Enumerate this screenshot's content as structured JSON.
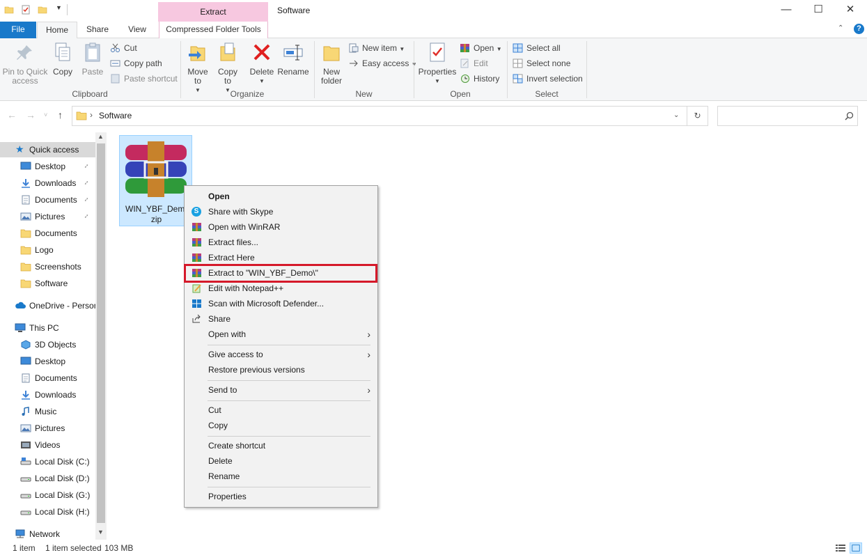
{
  "window": {
    "title": "Software",
    "contextual_tab_title": "Extract",
    "contextual_tab_group": "Compressed Folder Tools"
  },
  "tabs": {
    "file": "File",
    "home": "Home",
    "share": "Share",
    "view": "View"
  },
  "ribbon": {
    "clipboard": {
      "label": "Clipboard",
      "pin": "Pin to Quick access",
      "copy": "Copy",
      "paste": "Paste",
      "cut": "Cut",
      "copy_path": "Copy path",
      "paste_shortcut": "Paste shortcut"
    },
    "organize": {
      "label": "Organize",
      "move_to": "Move to",
      "copy_to": "Copy to",
      "delete": "Delete",
      "rename": "Rename"
    },
    "new": {
      "label": "New",
      "new_folder": "New folder",
      "new_item": "New item",
      "easy_access": "Easy access"
    },
    "open": {
      "label": "Open",
      "properties": "Properties",
      "open": "Open",
      "edit": "Edit",
      "history": "History"
    },
    "select": {
      "label": "Select",
      "select_all": "Select all",
      "select_none": "Select none",
      "invert": "Invert selection"
    }
  },
  "address": {
    "crumb": "Software",
    "search_placeholder": ""
  },
  "navpane": {
    "quick_access": "Quick access",
    "quick_items": [
      "Desktop",
      "Downloads",
      "Documents",
      "Pictures",
      "Documents",
      "Logo",
      "Screenshots",
      "Software"
    ],
    "onedrive": "OneDrive - Person",
    "this_pc": "This PC",
    "pc_items": [
      "3D Objects",
      "Desktop",
      "Documents",
      "Downloads",
      "Music",
      "Pictures",
      "Videos",
      "Local Disk (C:)",
      "Local Disk (D:)",
      "Local Disk (G:)",
      "Local Disk (H:)"
    ],
    "network": "Network"
  },
  "file": {
    "name_line1": "WIN_YBF_Demo.",
    "name_line2": "zip"
  },
  "context_menu": {
    "open": "Open",
    "share_skype": "Share with Skype",
    "open_winrar": "Open with WinRAR",
    "extract_files": "Extract files...",
    "extract_here": "Extract Here",
    "extract_to": "Extract to \"WIN_YBF_Demo\\\"",
    "edit_notepad": "Edit with Notepad++",
    "scan_defender": "Scan with Microsoft Defender...",
    "share": "Share",
    "open_with": "Open with",
    "give_access": "Give access to",
    "restore": "Restore previous versions",
    "send_to": "Send to",
    "cut": "Cut",
    "copy": "Copy",
    "create_shortcut": "Create shortcut",
    "delete": "Delete",
    "rename": "Rename",
    "properties": "Properties"
  },
  "status": {
    "count": "1 item",
    "selected": "1 item selected",
    "size": "103 MB"
  },
  "colors": {
    "accent": "#1979ca",
    "highlight": "#d5192a",
    "selection": "#cce8ff",
    "contextual": "#f7c8e0"
  }
}
